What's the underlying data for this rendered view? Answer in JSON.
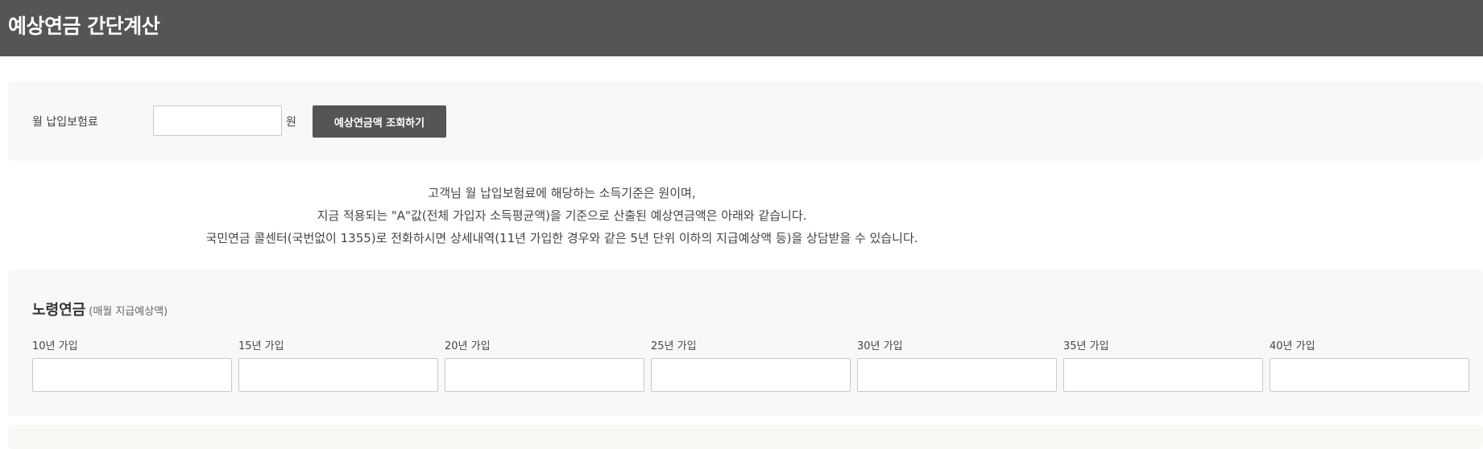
{
  "header": {
    "title": "예상연금 간단계산"
  },
  "calculator": {
    "label": "월 납입보험료",
    "amount_value": "",
    "unit": "원",
    "query_button": "예상연금액 조회하기"
  },
  "notice": {
    "lines": [
      "고객님 월 납입보험료에 해당하는 소득기준은 원이며,",
      "지금 적용되는 \"A\"값(전체 가입자 소득평균액)을 기준으로 산출된 예상연금액은 아래와 같습니다.",
      "국민연금 콜센터(국번없이 1355)로 전화하시면 상세내역(11년 가입한 경우와 같은 5년 단위 이하의 지급예상액 등)을 상담받을 수 있습니다."
    ]
  },
  "old_age_pension": {
    "title": "노령연금",
    "subtitle": "(매월 지급예상액)",
    "periods": [
      {
        "label": "10년 가입",
        "value": ""
      },
      {
        "label": "15년 가입",
        "value": ""
      },
      {
        "label": "20년 가입",
        "value": ""
      },
      {
        "label": "25년 가입",
        "value": ""
      },
      {
        "label": "30년 가입",
        "value": ""
      },
      {
        "label": "35년 가입",
        "value": ""
      },
      {
        "label": "40년 가입",
        "value": ""
      }
    ]
  }
}
